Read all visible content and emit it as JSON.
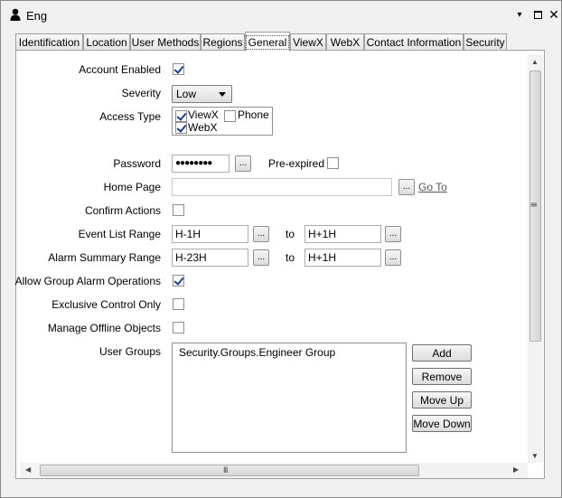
{
  "window": {
    "title": "Eng",
    "controls": {
      "dropdown": "▾",
      "maximize": "",
      "close": "✕"
    }
  },
  "tabs": [
    {
      "label": "Identification",
      "active": false
    },
    {
      "label": "Location",
      "active": false
    },
    {
      "label": "User Methods",
      "active": false
    },
    {
      "label": "Regions",
      "active": false
    },
    {
      "label": "General",
      "active": true
    },
    {
      "label": "ViewX",
      "active": false
    },
    {
      "label": "WebX",
      "active": false
    },
    {
      "label": "Contact Information",
      "active": false
    },
    {
      "label": "Security",
      "active": false
    }
  ],
  "form": {
    "account_enabled": {
      "label": "Account Enabled",
      "checked": true
    },
    "severity": {
      "label": "Severity",
      "value": "Low"
    },
    "access_type": {
      "label": "Access Type",
      "options": [
        {
          "label": "ViewX",
          "checked": true
        },
        {
          "label": "Phone",
          "checked": false
        },
        {
          "label": "WebX",
          "checked": true
        }
      ]
    },
    "password": {
      "label": "Password",
      "value": "●●●●●●●●",
      "browse": "...",
      "pre_expired_label": "Pre-expired",
      "pre_expired_checked": false
    },
    "home_page": {
      "label": "Home Page",
      "value": "",
      "browse": "...",
      "goto": "Go To"
    },
    "confirm_actions": {
      "label": "Confirm Actions",
      "checked": false
    },
    "event_list_range": {
      "label": "Event List Range",
      "from": "H-1H",
      "to_label": "to",
      "to": "H+1H",
      "browse": "..."
    },
    "alarm_summary_range": {
      "label": "Alarm Summary Range",
      "from": "H-23H",
      "to_label": "to",
      "to": "H+1H",
      "browse": "..."
    },
    "allow_group_alarm_operations": {
      "label": "Allow Group Alarm Operations",
      "checked": true
    },
    "exclusive_control_only": {
      "label": "Exclusive Control Only",
      "checked": false
    },
    "manage_offline_objects": {
      "label": "Manage Offline Objects",
      "checked": false
    },
    "user_groups": {
      "label": "User Groups",
      "items": [
        "Security.Groups.Engineer Group"
      ],
      "buttons": {
        "add": "Add",
        "remove": "Remove",
        "move_up": "Move Up",
        "move_down": "Move Down"
      }
    }
  },
  "scrollbars": {
    "up": "▲",
    "down": "▼",
    "left": "◀",
    "right": "▶",
    "grip": "III"
  }
}
